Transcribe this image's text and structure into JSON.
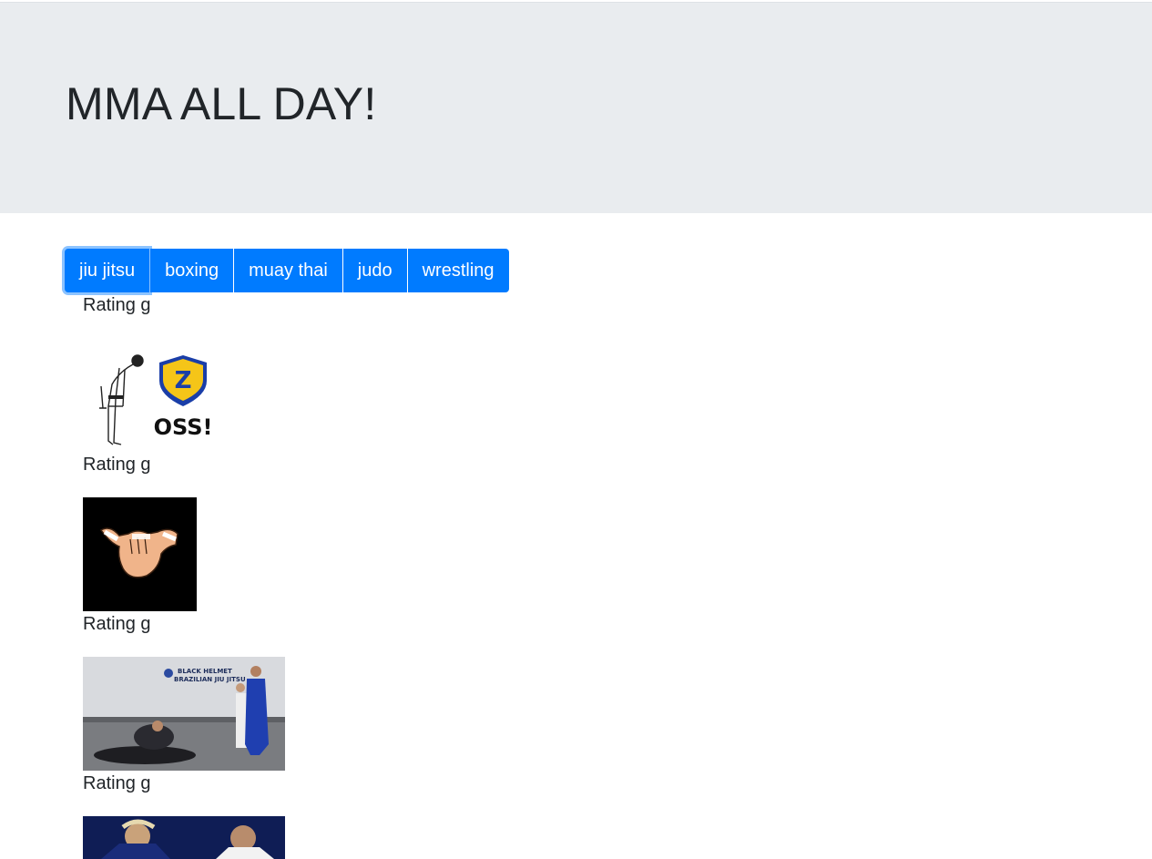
{
  "header": {
    "title": "MMA ALL DAY!"
  },
  "categories": [
    "jiu jitsu",
    "boxing",
    "muay thai",
    "judo",
    "wrestling"
  ],
  "results": [
    {
      "rating": "Rating g",
      "logo_text": "OSS!",
      "logo_letter": "Z"
    },
    {
      "rating": "Rating g"
    },
    {
      "rating": "Rating g",
      "banner_line1": "BLACK HELMET",
      "banner_line2": "BRAZILIAN JIU JITSU"
    },
    {
      "rating": "Rating g"
    }
  ]
}
